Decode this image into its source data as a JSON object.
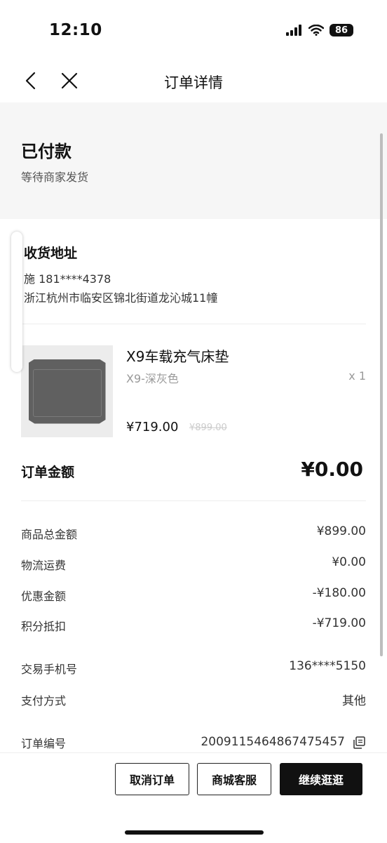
{
  "status_bar": {
    "time": "12:10",
    "battery": "86",
    "icons": [
      "signal-icon",
      "wifi-icon",
      "battery-icon"
    ]
  },
  "nav": {
    "title": "订单详情",
    "icons": [
      "back-chevron-icon",
      "close-icon"
    ]
  },
  "order_status": {
    "title": "已付款",
    "subtitle": "等待商家发货"
  },
  "address": {
    "title": "收货地址",
    "recipient_phone": "施 181****4378",
    "detail": "浙江杭州市临安区锦北街道龙沁城11幢"
  },
  "product": {
    "name": "X9车载充气床垫",
    "variant": "X9-深灰色",
    "quantity": "x 1",
    "price": "¥719.00",
    "original_price": "¥899.00",
    "image": "car-air-mattress-image"
  },
  "order_total": {
    "label": "订单金额",
    "value": "¥0.00"
  },
  "price_breakdown": [
    {
      "label": "商品总金额",
      "value": "¥899.00"
    },
    {
      "label": "物流运费",
      "value": "¥0.00"
    },
    {
      "label": "优惠金额",
      "value": "-¥180.00"
    },
    {
      "label": "积分抵扣",
      "value": "-¥719.00"
    }
  ],
  "order_info": [
    {
      "label": "交易手机号",
      "value": "136****5150"
    },
    {
      "label": "支付方式",
      "value": "其他"
    },
    {
      "label": "订单编号",
      "value": "2009115464867475457"
    }
  ],
  "actions": {
    "cancel": "取消订单",
    "service": "商城客服",
    "continue": "继续逛逛"
  },
  "colors": {
    "primary": "#111111",
    "section_bg": "#f6f6f6",
    "muted": "#999999"
  }
}
